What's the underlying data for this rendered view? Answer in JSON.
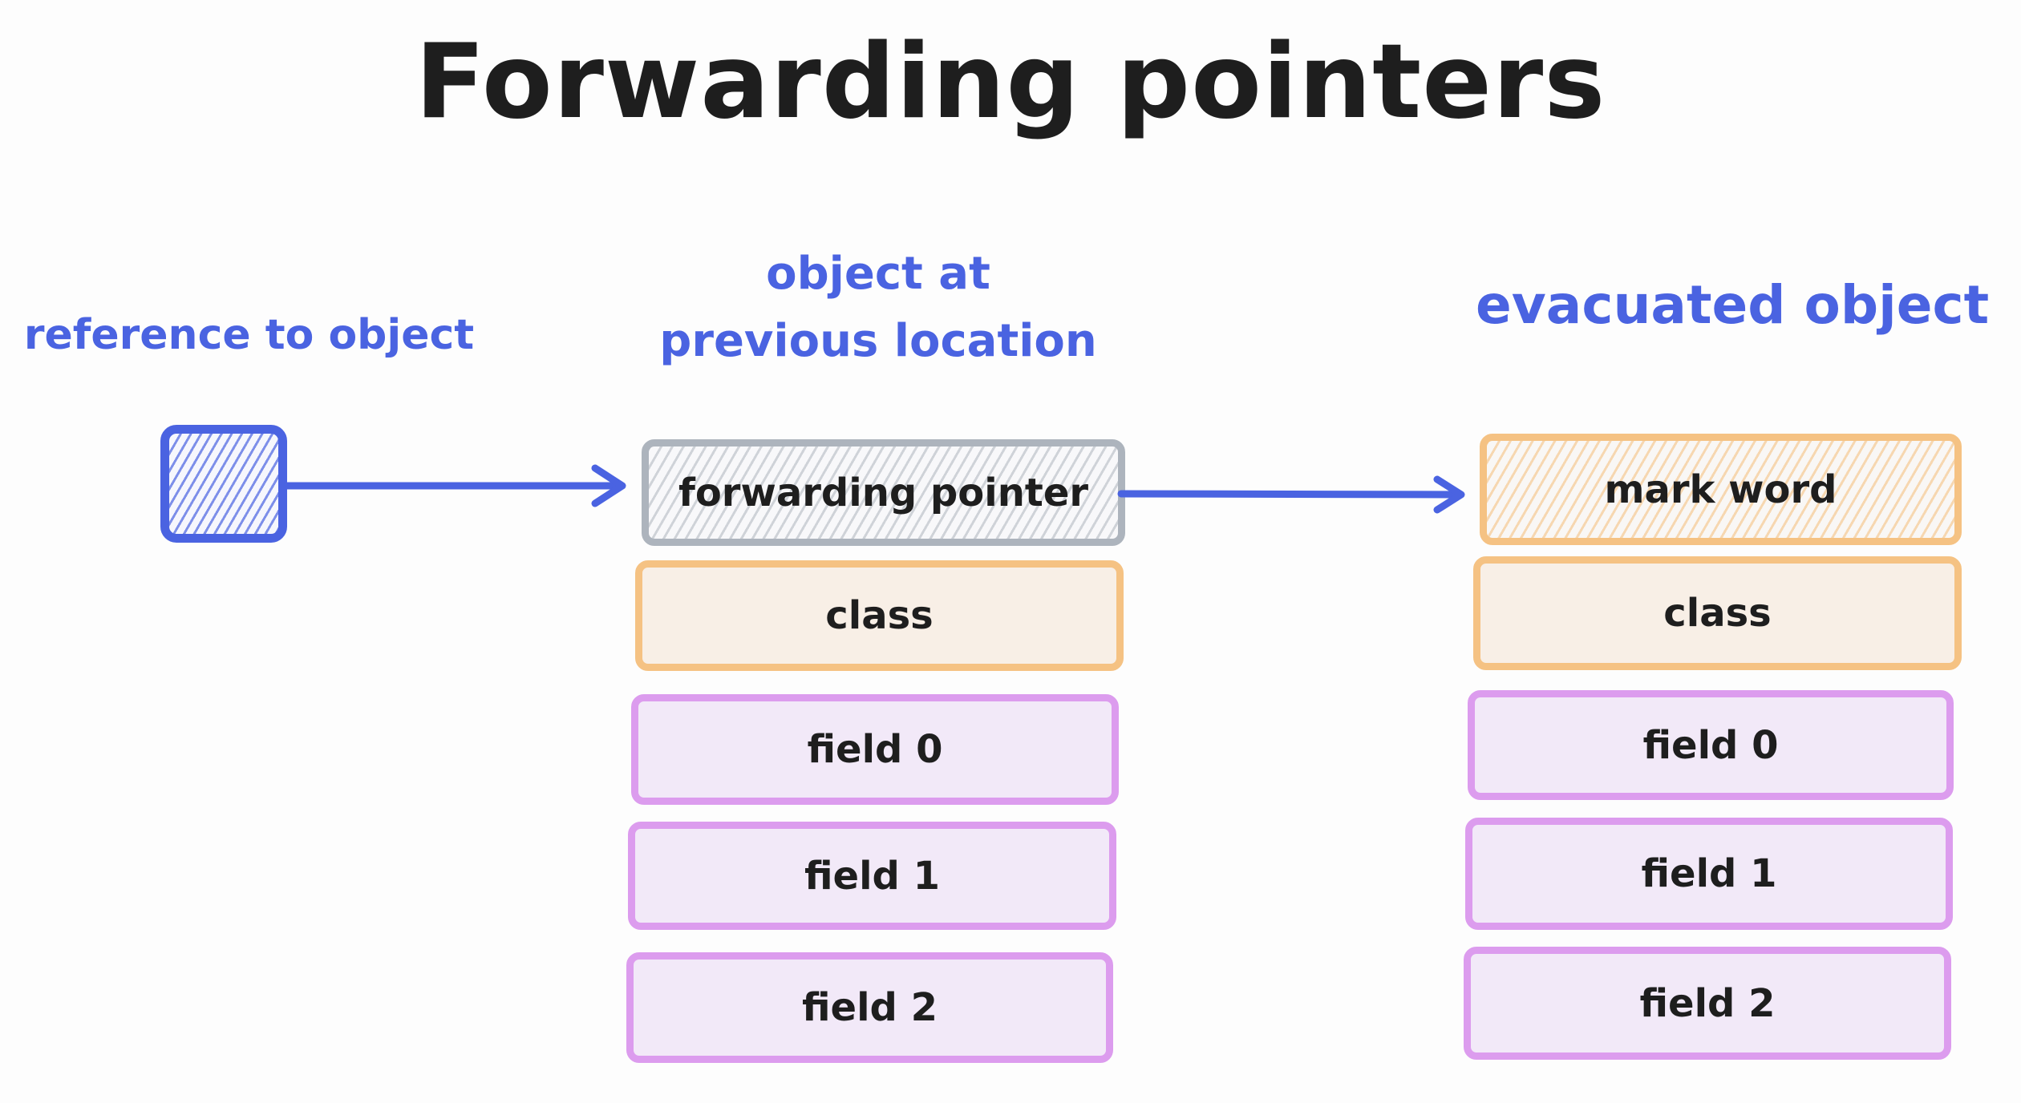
{
  "title": "Forwarding pointers",
  "labels": {
    "reference": "reference to object",
    "previous_line1": "object at",
    "previous_line2": "previous location",
    "evacuated": "evacuated object"
  },
  "old_object": {
    "cells": [
      "forwarding pointer",
      "class",
      "field 0",
      "field 1",
      "field 2"
    ]
  },
  "new_object": {
    "cells": [
      "mark word",
      "class",
      "field 0",
      "field 1",
      "field 2"
    ]
  },
  "arrows": [
    {
      "from": "reference to object",
      "to": "forwarding pointer"
    },
    {
      "from": "forwarding pointer",
      "to": "mark word"
    }
  ],
  "colors": {
    "accent_blue": "#4a63e1",
    "header_grey": "#adb4bd",
    "class_orange": "#f5c283",
    "field_purple": "#dc9cee",
    "text": "#1e1e1e"
  }
}
